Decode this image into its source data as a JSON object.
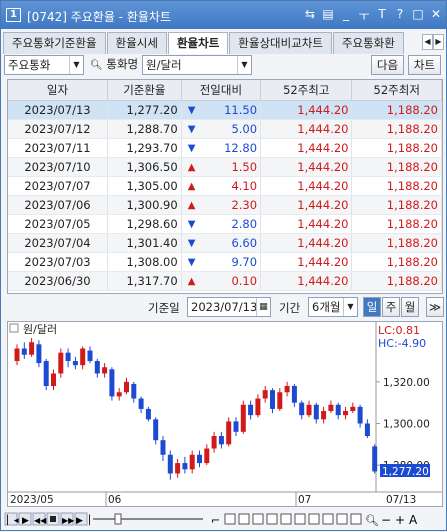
{
  "window": {
    "screen_no": "1",
    "title": "[0742] 주요환율 - 환율차트",
    "icons": [
      "link-icon",
      "print-icon",
      "minimize-icon",
      "pin-icon",
      "text-size-icon",
      "help-icon",
      "restore-icon",
      "close-icon"
    ],
    "icon_glyphs": [
      "⇆",
      "▤",
      "_",
      "ㅜ",
      "T",
      "?",
      "□",
      "✕"
    ]
  },
  "tabs": [
    {
      "label": "주요통화기준환율",
      "active": false
    },
    {
      "label": "환율시세",
      "active": false
    },
    {
      "label": "환율차트",
      "active": true
    },
    {
      "label": "환율상대비교차트",
      "active": false
    },
    {
      "label": "주요통화환",
      "active": false
    }
  ],
  "controls": {
    "currency_group": "주요통화",
    "currency_label": "통화명",
    "currency": "원/달러",
    "next_label": "다음",
    "chart_label": "차트"
  },
  "table": {
    "headers": [
      "일자",
      "기준환율",
      "전일대비",
      "52주최고",
      "52주최저"
    ],
    "rows": [
      {
        "date": "2023/07/13",
        "rate": "1,277.20",
        "dir": "down",
        "chg": "11.50",
        "high": "1,444.20",
        "low": "1,188.20"
      },
      {
        "date": "2023/07/12",
        "rate": "1,288.70",
        "dir": "down",
        "chg": "5.00",
        "high": "1,444.20",
        "low": "1,188.20"
      },
      {
        "date": "2023/07/11",
        "rate": "1,293.70",
        "dir": "down",
        "chg": "12.80",
        "high": "1,444.20",
        "low": "1,188.20"
      },
      {
        "date": "2023/07/10",
        "rate": "1,306.50",
        "dir": "up",
        "chg": "1.50",
        "high": "1,444.20",
        "low": "1,188.20"
      },
      {
        "date": "2023/07/07",
        "rate": "1,305.00",
        "dir": "up",
        "chg": "4.10",
        "high": "1,444.20",
        "low": "1,188.20"
      },
      {
        "date": "2023/07/06",
        "rate": "1,300.90",
        "dir": "up",
        "chg": "2.30",
        "high": "1,444.20",
        "low": "1,188.20"
      },
      {
        "date": "2023/07/05",
        "rate": "1,298.60",
        "dir": "down",
        "chg": "2.80",
        "high": "1,444.20",
        "low": "1,188.20"
      },
      {
        "date": "2023/07/04",
        "rate": "1,301.40",
        "dir": "down",
        "chg": "6.60",
        "high": "1,444.20",
        "low": "1,188.20"
      },
      {
        "date": "2023/07/03",
        "rate": "1,308.00",
        "dir": "down",
        "chg": "9.70",
        "high": "1,444.20",
        "low": "1,188.20"
      },
      {
        "date": "2023/06/30",
        "rate": "1,317.70",
        "dir": "up",
        "chg": "0.10",
        "high": "1,444.20",
        "low": "1,188.20"
      }
    ]
  },
  "query": {
    "base_date_label": "기준일",
    "base_date": "2023/07/13",
    "period_label": "기간",
    "period": "6개월",
    "units": [
      "일",
      "주",
      "월"
    ],
    "active_unit": "일",
    "more_label": "≫"
  },
  "chart": {
    "series_name": "원/달러",
    "lc_label": "LC:0.81",
    "hc_label": "HC:-4.90",
    "y_ticks": [
      "1,320.00",
      "1,300.00",
      "1,280.00"
    ],
    "current_price": "1,277.20",
    "x_labels": [
      "2023/05",
      "06",
      "07",
      "07/13"
    ],
    "colors": {
      "up": "#d21a1a",
      "down": "#1c4bd2",
      "price_tag": "#1c4bd2"
    }
  },
  "chart_data": {
    "type": "candlestick",
    "series_name": "원/달러",
    "y_ticks": [
      1320,
      1300,
      1280
    ],
    "current": 1277.2,
    "candles": [
      {
        "o": 1330,
        "c": 1336,
        "h": 1338,
        "l": 1328
      },
      {
        "o": 1336,
        "c": 1333,
        "h": 1339,
        "l": 1331
      },
      {
        "o": 1333,
        "c": 1339,
        "h": 1341,
        "l": 1332
      },
      {
        "o": 1338,
        "c": 1329,
        "h": 1340,
        "l": 1327
      },
      {
        "o": 1330,
        "c": 1318,
        "h": 1331,
        "l": 1316
      },
      {
        "o": 1318,
        "c": 1324,
        "h": 1326,
        "l": 1316
      },
      {
        "o": 1324,
        "c": 1334,
        "h": 1336,
        "l": 1322
      },
      {
        "o": 1334,
        "c": 1330,
        "h": 1336,
        "l": 1327
      },
      {
        "o": 1330,
        "c": 1328,
        "h": 1332,
        "l": 1326
      },
      {
        "o": 1328,
        "c": 1336,
        "h": 1337,
        "l": 1326
      },
      {
        "o": 1335,
        "c": 1330,
        "h": 1337,
        "l": 1329
      },
      {
        "o": 1330,
        "c": 1324,
        "h": 1331,
        "l": 1322
      },
      {
        "o": 1324,
        "c": 1327,
        "h": 1329,
        "l": 1322
      },
      {
        "o": 1326,
        "c": 1313,
        "h": 1327,
        "l": 1311
      },
      {
        "o": 1313,
        "c": 1315,
        "h": 1317,
        "l": 1311
      },
      {
        "o": 1315,
        "c": 1320,
        "h": 1322,
        "l": 1314
      },
      {
        "o": 1319,
        "c": 1312,
        "h": 1320,
        "l": 1310
      },
      {
        "o": 1312,
        "c": 1307,
        "h": 1313,
        "l": 1305
      },
      {
        "o": 1307,
        "c": 1302,
        "h": 1308,
        "l": 1301
      },
      {
        "o": 1302,
        "c": 1292,
        "h": 1303,
        "l": 1290
      },
      {
        "o": 1292,
        "c": 1285,
        "h": 1294,
        "l": 1282
      },
      {
        "o": 1285,
        "c": 1276,
        "h": 1287,
        "l": 1273
      },
      {
        "o": 1276,
        "c": 1281,
        "h": 1283,
        "l": 1274
      },
      {
        "o": 1281,
        "c": 1278,
        "h": 1284,
        "l": 1276
      },
      {
        "o": 1278,
        "c": 1285,
        "h": 1287,
        "l": 1276
      },
      {
        "o": 1285,
        "c": 1281,
        "h": 1287,
        "l": 1279
      },
      {
        "o": 1281,
        "c": 1288,
        "h": 1290,
        "l": 1280
      },
      {
        "o": 1288,
        "c": 1294,
        "h": 1296,
        "l": 1286
      },
      {
        "o": 1294,
        "c": 1290,
        "h": 1296,
        "l": 1288
      },
      {
        "o": 1290,
        "c": 1301,
        "h": 1303,
        "l": 1289
      },
      {
        "o": 1301,
        "c": 1296,
        "h": 1303,
        "l": 1294
      },
      {
        "o": 1296,
        "c": 1309,
        "h": 1311,
        "l": 1295
      },
      {
        "o": 1309,
        "c": 1304,
        "h": 1311,
        "l": 1302
      },
      {
        "o": 1304,
        "c": 1312,
        "h": 1314,
        "l": 1303
      },
      {
        "o": 1312,
        "c": 1316,
        "h": 1318,
        "l": 1310
      },
      {
        "o": 1316,
        "c": 1307,
        "h": 1317,
        "l": 1305
      },
      {
        "o": 1307,
        "c": 1315,
        "h": 1317,
        "l": 1306
      },
      {
        "o": 1315,
        "c": 1318,
        "h": 1320,
        "l": 1313
      },
      {
        "o": 1318,
        "c": 1310,
        "h": 1319,
        "l": 1308
      },
      {
        "o": 1310,
        "c": 1304,
        "h": 1311,
        "l": 1302
      },
      {
        "o": 1304,
        "c": 1309,
        "h": 1311,
        "l": 1303
      },
      {
        "o": 1309,
        "c": 1302,
        "h": 1310,
        "l": 1300
      },
      {
        "o": 1302,
        "c": 1306,
        "h": 1308,
        "l": 1300
      },
      {
        "o": 1306,
        "c": 1309,
        "h": 1311,
        "l": 1305
      },
      {
        "o": 1309,
        "c": 1304,
        "h": 1310,
        "l": 1302
      },
      {
        "o": 1304,
        "c": 1306,
        "h": 1308,
        "l": 1302
      },
      {
        "o": 1306,
        "c": 1308,
        "h": 1310,
        "l": 1305
      },
      {
        "o": 1308,
        "c": 1300,
        "h": 1309,
        "l": 1298
      },
      {
        "o": 1300,
        "c": 1294,
        "h": 1302,
        "l": 1293
      },
      {
        "o": 1289,
        "c": 1277,
        "h": 1290,
        "l": 1276
      }
    ]
  }
}
